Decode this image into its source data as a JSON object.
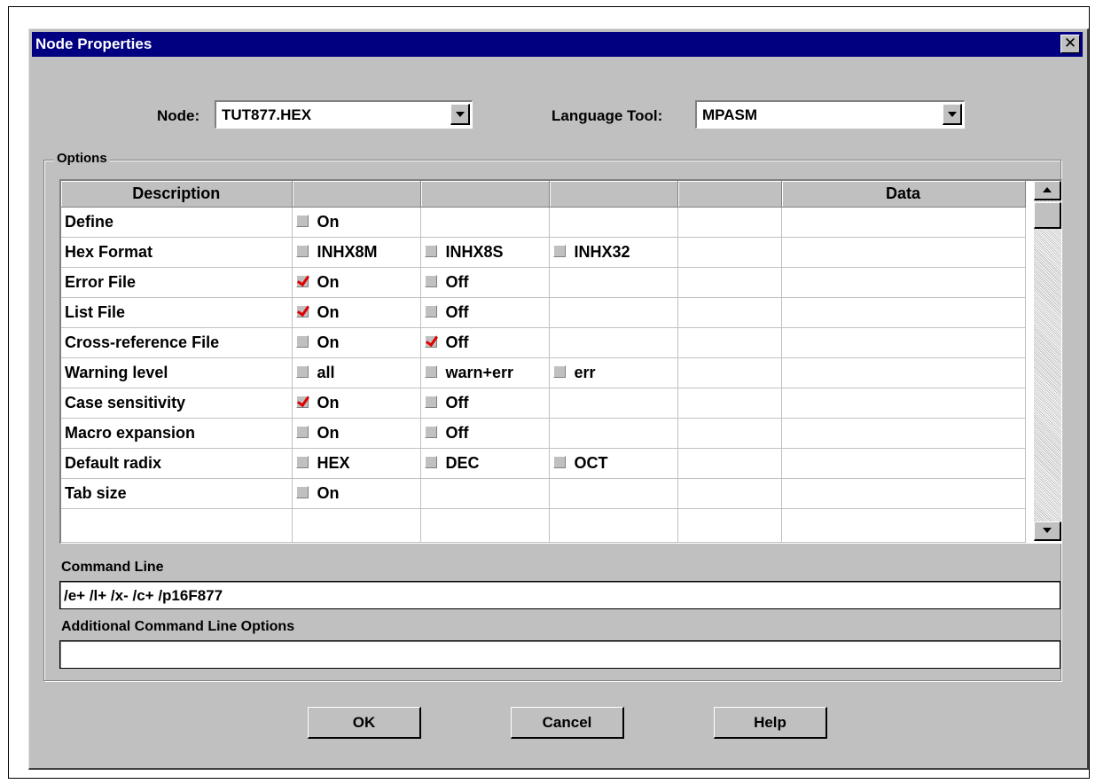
{
  "window": {
    "title": "Node Properties",
    "close_label": "✕"
  },
  "node": {
    "label": "Node:",
    "value": "TUT877.HEX"
  },
  "language_tool": {
    "label": "Language Tool:",
    "value": "MPASM"
  },
  "options": {
    "group_label": "Options",
    "columns": [
      "Description",
      "",
      "",
      "",
      "",
      "Data"
    ],
    "rows": [
      {
        "desc": "Define",
        "opts": [
          {
            "label": "On",
            "checked": false
          }
        ]
      },
      {
        "desc": "Hex Format",
        "opts": [
          {
            "label": "INHX8M",
            "checked": false
          },
          {
            "label": "INHX8S",
            "checked": false
          },
          {
            "label": "INHX32",
            "checked": false
          }
        ]
      },
      {
        "desc": "Error File",
        "opts": [
          {
            "label": "On",
            "checked": true
          },
          {
            "label": "Off",
            "checked": false
          }
        ]
      },
      {
        "desc": "List File",
        "opts": [
          {
            "label": "On",
            "checked": true
          },
          {
            "label": "Off",
            "checked": false
          }
        ]
      },
      {
        "desc": "Cross-reference File",
        "opts": [
          {
            "label": "On",
            "checked": false
          },
          {
            "label": "Off",
            "checked": true
          }
        ]
      },
      {
        "desc": "Warning level",
        "opts": [
          {
            "label": "all",
            "checked": false
          },
          {
            "label": "warn+err",
            "checked": false
          },
          {
            "label": "err",
            "checked": false
          }
        ]
      },
      {
        "desc": "Case sensitivity",
        "opts": [
          {
            "label": "On",
            "checked": true
          },
          {
            "label": "Off",
            "checked": false
          }
        ]
      },
      {
        "desc": "Macro expansion",
        "opts": [
          {
            "label": "On",
            "checked": false
          },
          {
            "label": "Off",
            "checked": false
          }
        ]
      },
      {
        "desc": "Default radix",
        "opts": [
          {
            "label": "HEX",
            "checked": false
          },
          {
            "label": "DEC",
            "checked": false
          },
          {
            "label": "OCT",
            "checked": false
          }
        ]
      },
      {
        "desc": "Tab size",
        "opts": [
          {
            "label": "On",
            "checked": false
          }
        ]
      }
    ]
  },
  "command_line": {
    "label": "Command Line",
    "value": "/e+ /l+ /x- /c+ /p16F877"
  },
  "additional_options": {
    "label": "Additional Command Line Options",
    "value": ""
  },
  "buttons": {
    "ok": "OK",
    "cancel": "Cancel",
    "help": "Help"
  },
  "colors": {
    "titlebar": "#000080",
    "face": "#c0c0c0",
    "check": "#e00000"
  }
}
